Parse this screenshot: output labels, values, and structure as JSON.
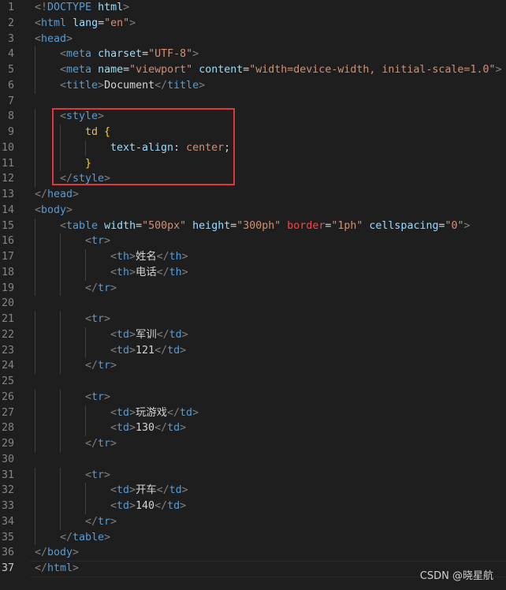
{
  "editor": {
    "language": "html",
    "active_line": 37,
    "lines": [
      {
        "n": "1",
        "indent": 0,
        "tokens": [
          [
            "<!",
            "bracket"
          ],
          [
            "DOCTYPE ",
            "tag"
          ],
          [
            "html",
            "attr"
          ],
          [
            ">",
            "bracket"
          ]
        ]
      },
      {
        "n": "2",
        "indent": 0,
        "tokens": [
          [
            "<",
            "bracket"
          ],
          [
            "html",
            "tag"
          ],
          [
            " ",
            "text"
          ],
          [
            "lang",
            "attr"
          ],
          [
            "=",
            "eq"
          ],
          [
            "\"en\"",
            "str"
          ],
          [
            ">",
            "bracket"
          ]
        ]
      },
      {
        "n": "3",
        "indent": 0,
        "tokens": [
          [
            "<",
            "bracket"
          ],
          [
            "head",
            "tag"
          ],
          [
            ">",
            "bracket"
          ]
        ]
      },
      {
        "n": "4",
        "indent": 1,
        "tokens": [
          [
            "<",
            "bracket"
          ],
          [
            "meta",
            "tag"
          ],
          [
            " ",
            "text"
          ],
          [
            "charset",
            "attr"
          ],
          [
            "=",
            "eq"
          ],
          [
            "\"UTF-8\"",
            "str"
          ],
          [
            ">",
            "bracket"
          ]
        ]
      },
      {
        "n": "5",
        "indent": 1,
        "tokens": [
          [
            "<",
            "bracket"
          ],
          [
            "meta",
            "tag"
          ],
          [
            " ",
            "text"
          ],
          [
            "name",
            "attr"
          ],
          [
            "=",
            "eq"
          ],
          [
            "\"viewport\"",
            "str"
          ],
          [
            " ",
            "text"
          ],
          [
            "content",
            "attr"
          ],
          [
            "=",
            "eq"
          ],
          [
            "\"width=device-width, initial-scale=1.0\"",
            "str"
          ],
          [
            ">",
            "bracket"
          ]
        ]
      },
      {
        "n": "6",
        "indent": 1,
        "tokens": [
          [
            "<",
            "bracket"
          ],
          [
            "title",
            "tag"
          ],
          [
            ">",
            "bracket"
          ],
          [
            "Document",
            "text"
          ],
          [
            "</",
            "bracket"
          ],
          [
            "title",
            "tag"
          ],
          [
            ">",
            "bracket"
          ]
        ]
      },
      {
        "n": "7",
        "indent": 0,
        "tokens": []
      },
      {
        "n": "8",
        "indent": 1,
        "tokens": [
          [
            "<",
            "bracket"
          ],
          [
            "style",
            "tag"
          ],
          [
            ">",
            "bracket"
          ]
        ]
      },
      {
        "n": "9",
        "indent": 2,
        "tokens": [
          [
            "td ",
            "sel"
          ],
          [
            "{",
            "brace"
          ]
        ]
      },
      {
        "n": "10",
        "indent": 3,
        "tokens": [
          [
            "text-align",
            "prop"
          ],
          [
            ": ",
            "punct"
          ],
          [
            "center",
            "val"
          ],
          [
            ";",
            "punct"
          ]
        ]
      },
      {
        "n": "11",
        "indent": 2,
        "tokens": [
          [
            "}",
            "brace"
          ]
        ]
      },
      {
        "n": "12",
        "indent": 1,
        "tokens": [
          [
            "</",
            "bracket"
          ],
          [
            "style",
            "tag"
          ],
          [
            ">",
            "bracket"
          ]
        ]
      },
      {
        "n": "13",
        "indent": 0,
        "tokens": [
          [
            "</",
            "bracket"
          ],
          [
            "head",
            "tag"
          ],
          [
            ">",
            "bracket"
          ]
        ]
      },
      {
        "n": "14",
        "indent": 0,
        "tokens": [
          [
            "<",
            "bracket"
          ],
          [
            "body",
            "tag"
          ],
          [
            ">",
            "bracket"
          ]
        ]
      },
      {
        "n": "15",
        "indent": 1,
        "tokens": [
          [
            "<",
            "bracket"
          ],
          [
            "table",
            "tag"
          ],
          [
            " ",
            "text"
          ],
          [
            "width",
            "attr"
          ],
          [
            "=",
            "eq"
          ],
          [
            "\"500px\"",
            "str"
          ],
          [
            " ",
            "text"
          ],
          [
            "height",
            "attr"
          ],
          [
            "=",
            "eq"
          ],
          [
            "\"300ph\"",
            "str"
          ],
          [
            " ",
            "text"
          ],
          [
            "border",
            "attr-warn"
          ],
          [
            "=",
            "eq"
          ],
          [
            "\"1ph\"",
            "str"
          ],
          [
            " ",
            "text"
          ],
          [
            "cellspacing",
            "attr"
          ],
          [
            "=",
            "eq"
          ],
          [
            "\"0\"",
            "str"
          ],
          [
            ">",
            "bracket"
          ]
        ]
      },
      {
        "n": "16",
        "indent": 2,
        "tokens": [
          [
            "<",
            "bracket"
          ],
          [
            "tr",
            "tag"
          ],
          [
            ">",
            "bracket"
          ]
        ]
      },
      {
        "n": "17",
        "indent": 3,
        "tokens": [
          [
            "<",
            "bracket"
          ],
          [
            "th",
            "tag"
          ],
          [
            ">",
            "bracket"
          ],
          [
            "姓名",
            "text"
          ],
          [
            "</",
            "bracket"
          ],
          [
            "th",
            "tag"
          ],
          [
            ">",
            "bracket"
          ]
        ]
      },
      {
        "n": "18",
        "indent": 3,
        "tokens": [
          [
            "<",
            "bracket"
          ],
          [
            "th",
            "tag"
          ],
          [
            ">",
            "bracket"
          ],
          [
            "电话",
            "text"
          ],
          [
            "</",
            "bracket"
          ],
          [
            "th",
            "tag"
          ],
          [
            ">",
            "bracket"
          ]
        ]
      },
      {
        "n": "19",
        "indent": 2,
        "tokens": [
          [
            "</",
            "bracket"
          ],
          [
            "tr",
            "tag"
          ],
          [
            ">",
            "bracket"
          ]
        ]
      },
      {
        "n": "20",
        "indent": 0,
        "tokens": []
      },
      {
        "n": "21",
        "indent": 2,
        "tokens": [
          [
            "<",
            "bracket"
          ],
          [
            "tr",
            "tag"
          ],
          [
            ">",
            "bracket"
          ]
        ]
      },
      {
        "n": "22",
        "indent": 3,
        "tokens": [
          [
            "<",
            "bracket"
          ],
          [
            "td",
            "tag"
          ],
          [
            ">",
            "bracket"
          ],
          [
            "军训",
            "text"
          ],
          [
            "</",
            "bracket"
          ],
          [
            "td",
            "tag"
          ],
          [
            ">",
            "bracket"
          ]
        ]
      },
      {
        "n": "23",
        "indent": 3,
        "tokens": [
          [
            "<",
            "bracket"
          ],
          [
            "td",
            "tag"
          ],
          [
            ">",
            "bracket"
          ],
          [
            "121",
            "text"
          ],
          [
            "</",
            "bracket"
          ],
          [
            "td",
            "tag"
          ],
          [
            ">",
            "bracket"
          ]
        ]
      },
      {
        "n": "24",
        "indent": 2,
        "tokens": [
          [
            "</",
            "bracket"
          ],
          [
            "tr",
            "tag"
          ],
          [
            ">",
            "bracket"
          ]
        ]
      },
      {
        "n": "25",
        "indent": 0,
        "tokens": []
      },
      {
        "n": "26",
        "indent": 2,
        "tokens": [
          [
            "<",
            "bracket"
          ],
          [
            "tr",
            "tag"
          ],
          [
            ">",
            "bracket"
          ]
        ]
      },
      {
        "n": "27",
        "indent": 3,
        "tokens": [
          [
            "<",
            "bracket"
          ],
          [
            "td",
            "tag"
          ],
          [
            ">",
            "bracket"
          ],
          [
            "玩游戏",
            "text"
          ],
          [
            "</",
            "bracket"
          ],
          [
            "td",
            "tag"
          ],
          [
            ">",
            "bracket"
          ]
        ]
      },
      {
        "n": "28",
        "indent": 3,
        "tokens": [
          [
            "<",
            "bracket"
          ],
          [
            "td",
            "tag"
          ],
          [
            ">",
            "bracket"
          ],
          [
            "130",
            "text"
          ],
          [
            "</",
            "bracket"
          ],
          [
            "td",
            "tag"
          ],
          [
            ">",
            "bracket"
          ]
        ]
      },
      {
        "n": "29",
        "indent": 2,
        "tokens": [
          [
            "</",
            "bracket"
          ],
          [
            "tr",
            "tag"
          ],
          [
            ">",
            "bracket"
          ]
        ]
      },
      {
        "n": "30",
        "indent": 0,
        "tokens": []
      },
      {
        "n": "31",
        "indent": 2,
        "tokens": [
          [
            "<",
            "bracket"
          ],
          [
            "tr",
            "tag"
          ],
          [
            ">",
            "bracket"
          ]
        ]
      },
      {
        "n": "32",
        "indent": 3,
        "tokens": [
          [
            "<",
            "bracket"
          ],
          [
            "td",
            "tag"
          ],
          [
            ">",
            "bracket"
          ],
          [
            "开车",
            "text"
          ],
          [
            "</",
            "bracket"
          ],
          [
            "td",
            "tag"
          ],
          [
            ">",
            "bracket"
          ]
        ]
      },
      {
        "n": "33",
        "indent": 3,
        "tokens": [
          [
            "<",
            "bracket"
          ],
          [
            "td",
            "tag"
          ],
          [
            ">",
            "bracket"
          ],
          [
            "140",
            "text"
          ],
          [
            "</",
            "bracket"
          ],
          [
            "td",
            "tag"
          ],
          [
            ">",
            "bracket"
          ]
        ]
      },
      {
        "n": "34",
        "indent": 2,
        "tokens": [
          [
            "</",
            "bracket"
          ],
          [
            "tr",
            "tag"
          ],
          [
            ">",
            "bracket"
          ]
        ]
      },
      {
        "n": "35",
        "indent": 1,
        "tokens": [
          [
            "</",
            "bracket"
          ],
          [
            "table",
            "tag"
          ],
          [
            ">",
            "bracket"
          ]
        ]
      },
      {
        "n": "36",
        "indent": 0,
        "tokens": [
          [
            "</",
            "bracket"
          ],
          [
            "body",
            "tag"
          ],
          [
            ">",
            "bracket"
          ]
        ]
      },
      {
        "n": "37",
        "indent": 0,
        "tokens": [
          [
            "</",
            "bracket"
          ],
          [
            "html",
            "tag"
          ],
          [
            ">",
            "bracket"
          ]
        ]
      }
    ]
  },
  "watermark": {
    "text": "CSDN @晓星航"
  },
  "colors": {
    "background": "#1e1e1e",
    "highlight_box": "#e0353b",
    "tag": "#569cd6",
    "attribute": "#9cdcfe",
    "string": "#ce9178"
  }
}
